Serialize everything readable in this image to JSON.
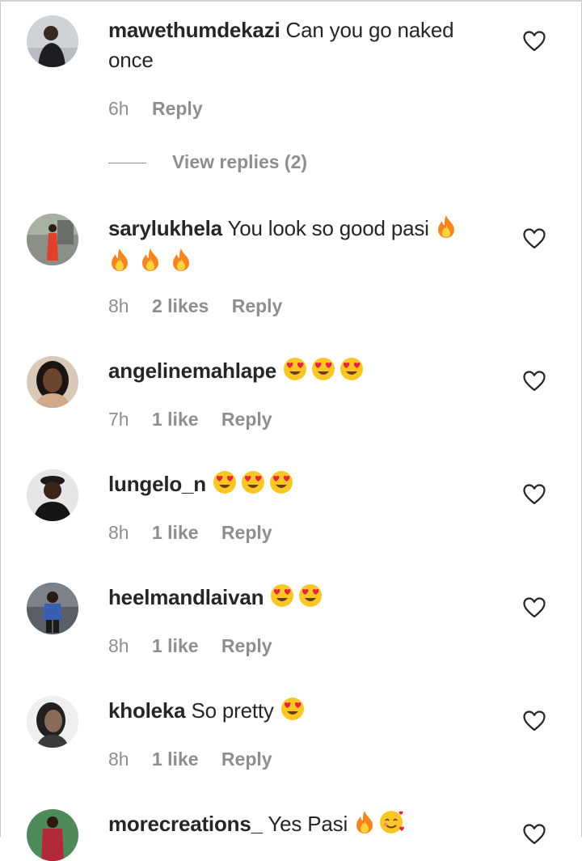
{
  "actions": {
    "reply_label": "Reply"
  },
  "thread": {
    "view_replies_label": "View replies (2)"
  },
  "comments": [
    {
      "username": "mawethumdekazi",
      "text": "Can you go naked once",
      "time": "6h",
      "likes": "",
      "emoji": []
    },
    {
      "username": "sarylukhela",
      "text": "You look so good pasi",
      "time": "8h",
      "likes": "2 likes",
      "emoji": [
        "fire",
        "fire",
        "fire",
        "fire"
      ]
    },
    {
      "username": "angelinemahlape",
      "text": "",
      "time": "7h",
      "likes": "1 like",
      "emoji": [
        "heart-eyes",
        "heart-eyes",
        "heart-eyes"
      ]
    },
    {
      "username": "lungelo_n",
      "text": "",
      "time": "8h",
      "likes": "1 like",
      "emoji": [
        "heart-eyes",
        "heart-eyes",
        "heart-eyes"
      ]
    },
    {
      "username": "heelmandlaivan",
      "text": "",
      "time": "8h",
      "likes": "1 like",
      "emoji": [
        "heart-eyes",
        "heart-eyes"
      ]
    },
    {
      "username": "kholeka",
      "text": "So pretty",
      "time": "8h",
      "likes": "1 like",
      "emoji": [
        "heart-eyes"
      ]
    },
    {
      "username": "morecreations_",
      "text": "Yes Pasi",
      "time": "",
      "likes": "",
      "emoji": [
        "fire",
        "smiling-face-with-hearts"
      ]
    }
  ],
  "colors": {
    "text": "#262626",
    "secondary": "#8e8e8e",
    "emoji_yellow": "#f9c623",
    "fire": "#f6851f"
  }
}
